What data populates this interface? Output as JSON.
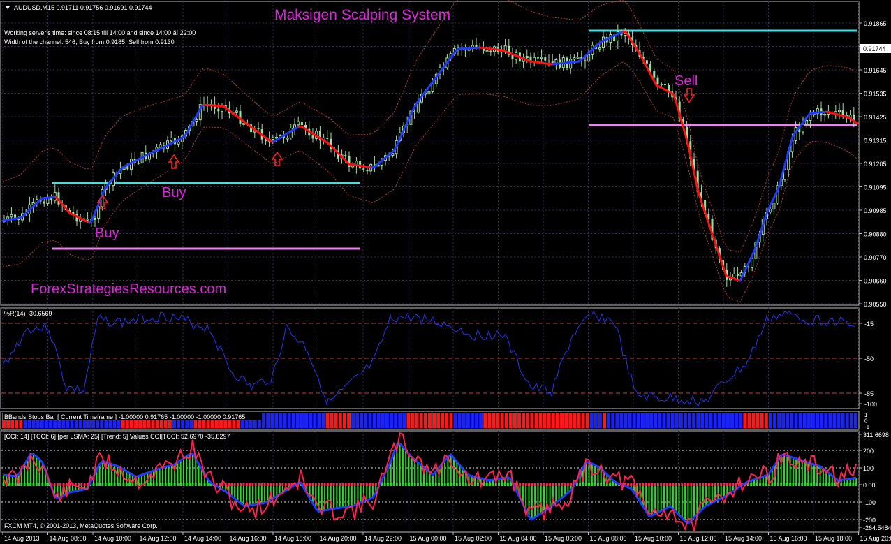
{
  "main": {
    "symbol_header": "AUDUSD,M15  0.91711 0.91756 0.91691 0.91744",
    "title": "Maksigen Scalping System",
    "info_line1": "Working server's time: since 08:15 till 14:00 and since 14:00 äî 22:00",
    "info_line2": "Width of the channel: 546, Buy from 0.9185, Sell from 0.9130",
    "watermark": "ForexStrategiesResources.com",
    "current_price": "0.91744",
    "price_ticks": [
      "0.91865",
      "0.91755",
      "0.91645",
      "0.91535",
      "0.91425",
      "0.91315",
      "0.91205",
      "0.91095",
      "0.90985",
      "0.90880",
      "0.90770",
      "0.90660",
      "0.90550"
    ],
    "signals": [
      {
        "label": "Buy",
        "arrow": "up"
      },
      {
        "label": "Buy",
        "arrow": "up"
      },
      {
        "label": "Sell",
        "arrow": "down"
      }
    ]
  },
  "wpr": {
    "header": "%R(14) -30.6569",
    "ticks": [
      "-15",
      "-50",
      "-85",
      "-100"
    ]
  },
  "bbands": {
    "header": "BBands Stops Bar  [ Current Timeframe ]  -1.00000 0.91765 -1.00000 -1.00000 0.91765",
    "ticks": [
      "1",
      "0",
      "-1"
    ]
  },
  "cci": {
    "header": "[CCI: 14] [TCCI: 6] [per LSMA: 25] [Trend: 5] Values CCI|TCCI: 52.6970 -35.8297",
    "ticks": [
      "311.6698",
      "200",
      "100",
      "0.00",
      "-100",
      "-200",
      "-264.5484"
    ]
  },
  "footer": {
    "copyright": "FXCM MT4, © 2001-2013, MetaQuotes Software Corp.",
    "time_ticks": [
      "14 Aug 2013",
      "14 Aug 08:00",
      "14 Aug 10:00",
      "14 Aug 12:00",
      "14 Aug 14:00",
      "14 Aug 16:00",
      "14 Aug 18:00",
      "14 Aug 20:00",
      "14 Aug 22:00",
      "15 Aug 00:00",
      "15 Aug 02:00",
      "15 Aug 04:00",
      "15 Aug 06:00",
      "15 Aug 08:00",
      "15 Aug 10:00",
      "15 Aug 12:00",
      "15 Aug 14:00",
      "15 Aug 16:00",
      "15 Aug 18:00",
      "15 Aug 20:00"
    ]
  },
  "colors": {
    "background": "#000000",
    "grid": "#3b2a55",
    "axis": "#c0c0c0",
    "candle": "#9fe0a0",
    "ma_up": "#1e3cff",
    "ma_down": "#ff1010",
    "cyan_level": "#40e0e0",
    "pink_level": "#f080f0",
    "title": "#e020e0",
    "signal_text": "#e020e0",
    "arrow": "#ff2020",
    "band": "#b03a2a",
    "wpr_line": "#2233ee",
    "level_line": "#c04040",
    "bar_blue": "#1a22ff",
    "bar_red": "#ff1818",
    "hist_green": "#20e020",
    "cci_blue": "#1e3cff",
    "cci_red": "#ff2050"
  }
}
